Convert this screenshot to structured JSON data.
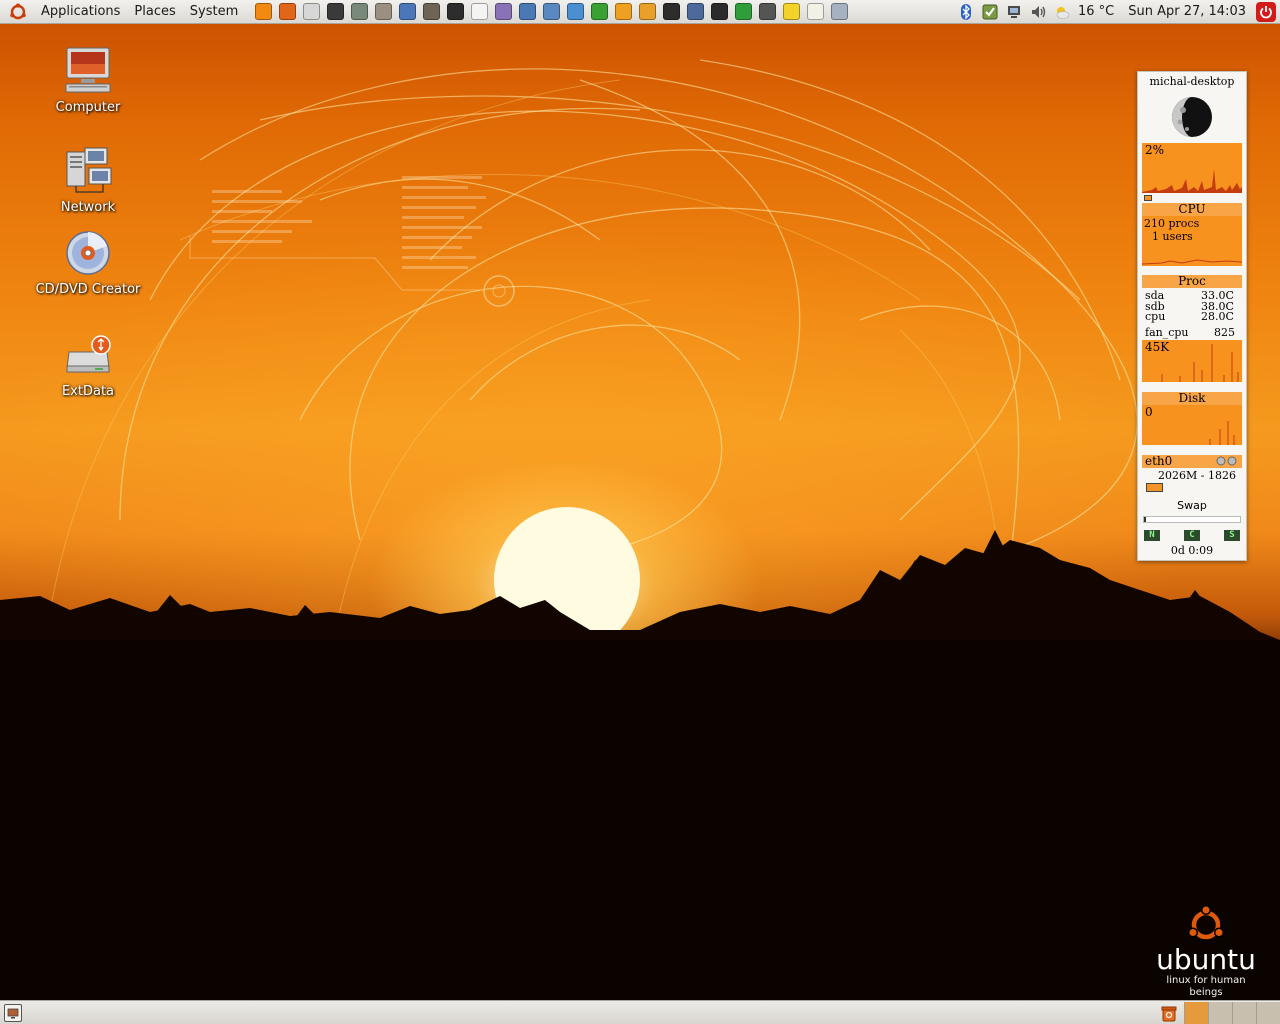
{
  "top_panel": {
    "menus": [
      "Applications",
      "Places",
      "System"
    ],
    "launchers": [
      {
        "icon": "vlc-icon",
        "color": "#f28a12"
      },
      {
        "icon": "firefox-icon",
        "color": "#e2661a"
      },
      {
        "icon": "mail-icon",
        "color": "#d7d7d7"
      },
      {
        "icon": "terminal-icon",
        "color": "#3a3a3a"
      },
      {
        "icon": "calculator-icon",
        "color": "#7a8a7a"
      },
      {
        "icon": "network-tool-icon",
        "color": "#9a8f80"
      },
      {
        "icon": "web-icon",
        "color": "#4b76b8"
      },
      {
        "icon": "gimp-icon",
        "color": "#6d6456"
      },
      {
        "icon": "inkscape-icon",
        "color": "#2d2d2d"
      },
      {
        "icon": "document-icon",
        "color": "#f4f4f4"
      },
      {
        "icon": "pidgin-icon",
        "color": "#8a72b6"
      },
      {
        "icon": "remote-desktop-icon",
        "color": "#4a79b4"
      },
      {
        "icon": "network-manager-icon",
        "color": "#5a88c0"
      },
      {
        "icon": "tasks-icon",
        "color": "#4a8fd0"
      },
      {
        "icon": "system-monitor-icon",
        "color": "#39a033"
      },
      {
        "icon": "rhythmbox-icon",
        "color": "#f0a020"
      },
      {
        "icon": "brasero-icon",
        "color": "#e9a02a"
      },
      {
        "icon": "video-editor-icon",
        "color": "#2d2d2d"
      },
      {
        "icon": "presentation-icon",
        "color": "#4e6a9a"
      },
      {
        "icon": "scissors-icon",
        "color": "#2b2b2b"
      },
      {
        "icon": "qt-icon",
        "color": "#2e9d3a"
      },
      {
        "icon": "camera-icon",
        "color": "#555555"
      },
      {
        "icon": "notes-icon",
        "color": "#f3d22a"
      },
      {
        "icon": "text-editor-icon",
        "color": "#f1f1e6"
      },
      {
        "icon": "printer-icon",
        "color": "#a6b2c2"
      }
    ],
    "tray": {
      "temperature": "16 °C",
      "clock": "Sun Apr 27, 14:03"
    }
  },
  "desktop_icons": [
    {
      "label": "Computer",
      "icon": "computer-icon"
    },
    {
      "label": "Network",
      "icon": "network-icon"
    },
    {
      "label": "CD/DVD Creator",
      "icon": "cd-dvd-icon"
    },
    {
      "label": "ExtData",
      "icon": "usb-drive-icon"
    }
  ],
  "conky": {
    "hostname": "michal-desktop",
    "cpu_percent": "2%",
    "cpu_title": "CPU",
    "procs": "210 procs",
    "users": "1 users",
    "proc_title": "Proc",
    "sensors": [
      {
        "name": "sda",
        "value": "33.0C"
      },
      {
        "name": "sdb",
        "value": "38.0C"
      },
      {
        "name": "cpu",
        "value": "28.0C"
      }
    ],
    "fan_label": "fan_cpu",
    "fan_value": "825",
    "net_value": "45K",
    "disk_title": "Disk",
    "disk_value": "0",
    "eth_label": "eth0",
    "memory": "2026M - 1826",
    "swap_title": "Swap",
    "status_cells": [
      "N",
      "C",
      "S"
    ],
    "uptime": "0d 0:09",
    "graph_color": "#f8921e"
  },
  "branding": {
    "word": "ubuntu",
    "tagline": "linux for human beings",
    "logo_color": "#e05a0b"
  }
}
